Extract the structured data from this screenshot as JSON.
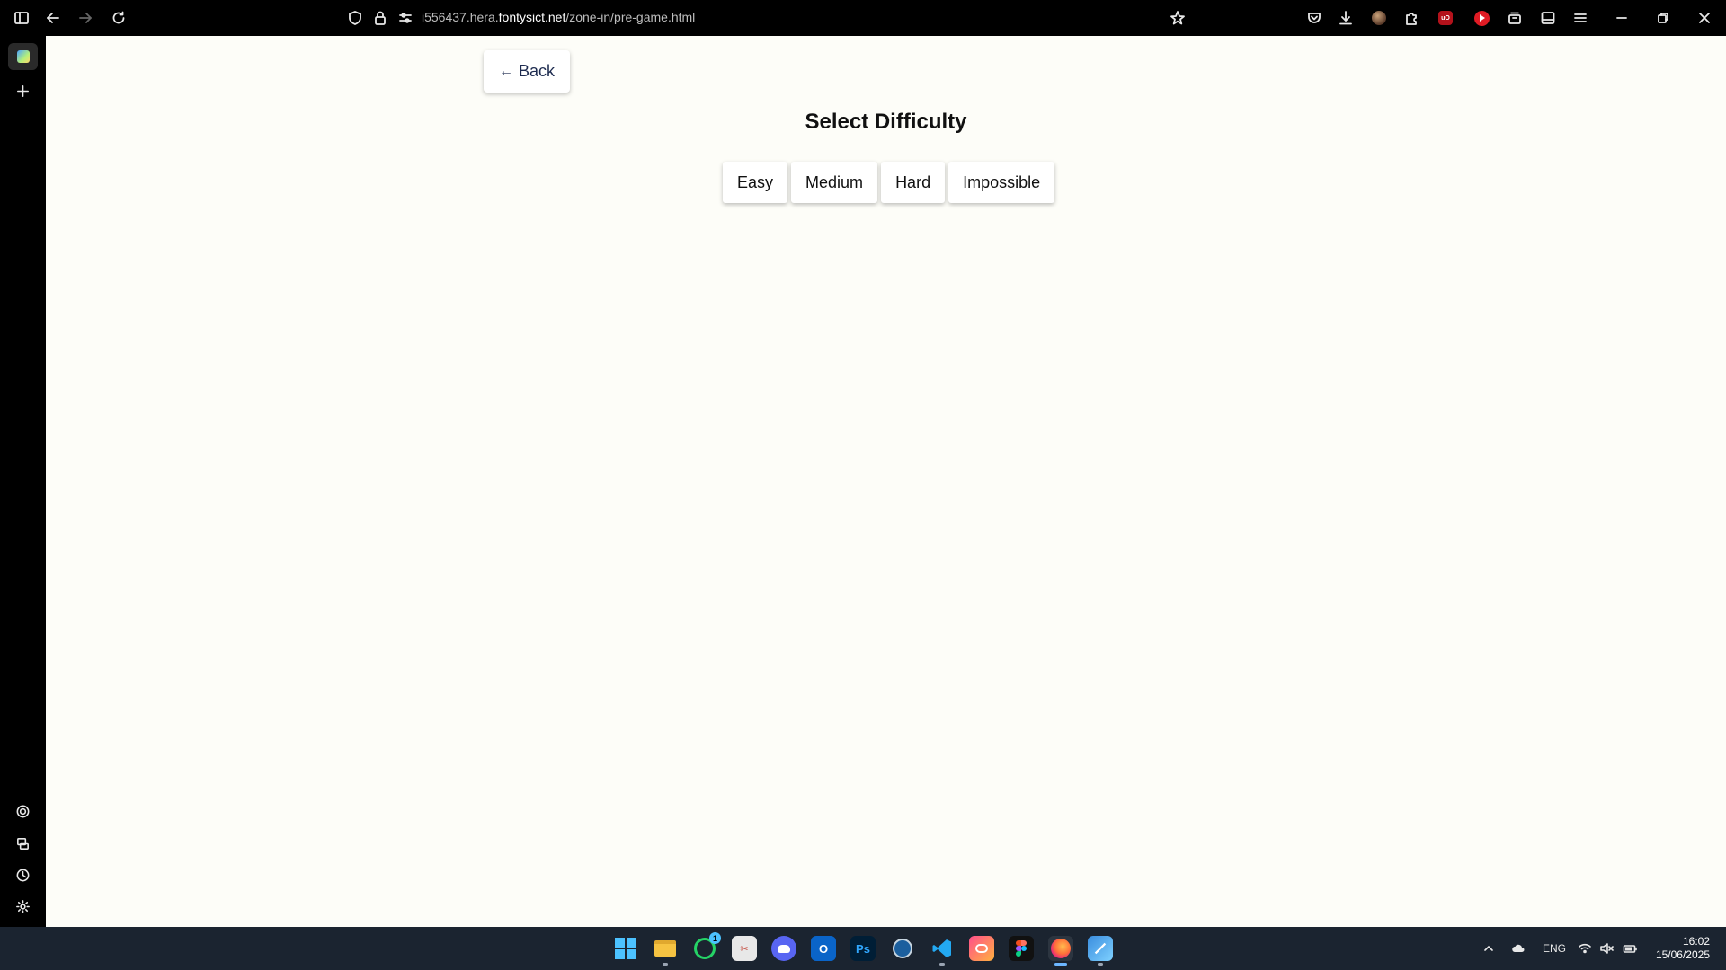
{
  "browser": {
    "url_prefix": "i556437.hera.",
    "url_domain": "fontysict.net",
    "url_path": "/zone-in/pre-game.html"
  },
  "page": {
    "back_label": "Back",
    "back_arrow": "←",
    "title": "Select Difficulty",
    "difficulties": [
      "Easy",
      "Medium",
      "Hard",
      "Impossible"
    ]
  },
  "taskbar": {
    "whatsapp_badge": "1",
    "language": "ENG",
    "time": "16:02",
    "date": "15/06/2025"
  }
}
